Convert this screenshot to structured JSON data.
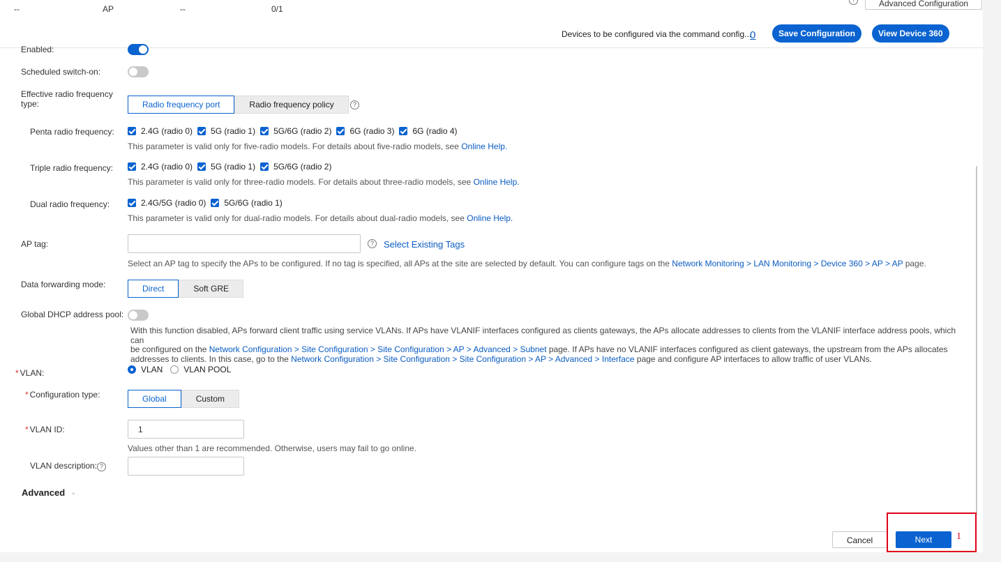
{
  "table_row": {
    "col1": "--",
    "col2": "AP",
    "col3": "--",
    "col4": "0/1"
  },
  "header": {
    "advanced_config": "Advanced Configuration",
    "devices_text": "Devices to be configured via the command config...",
    "devices_count": "0",
    "save_config": "Save Configuration",
    "view_device": "View Device 360"
  },
  "form": {
    "enabled_label": "Enabled:",
    "scheduled_label": "Scheduled switch-on:",
    "effective_label": "Effective radio frequency type:",
    "effective_options": [
      "Radio frequency port",
      "Radio frequency policy"
    ],
    "penta": {
      "label": "Penta radio frequency:",
      "options": [
        "2.4G (radio 0)",
        "5G (radio 1)",
        "5G/6G (radio 2)",
        "6G (radio 3)",
        "6G (radio 4)"
      ],
      "hint": "This parameter is valid only for five-radio models. For details about five-radio models, see ",
      "link": "Online Help."
    },
    "triple": {
      "label": "Triple radio frequency:",
      "options": [
        "2.4G (radio 0)",
        "5G (radio 1)",
        "5G/6G (radio 2)"
      ],
      "hint": "This parameter is valid only for three-radio models. For details about three-radio models, see ",
      "link": "Online Help."
    },
    "dual": {
      "label": "Dual radio frequency:",
      "options": [
        "2.4G/5G (radio 0)",
        "5G/6G (radio 1)"
      ],
      "hint": "This parameter is valid only for dual-radio models. For details about dual-radio models, see ",
      "link": "Online Help."
    },
    "ap_tag": {
      "label": "AP tag:",
      "value": "",
      "select_existing": "Select Existing Tags",
      "hint_before": "Select an AP tag to specify the APs to be configured. If no tag is specified, all APs at the site are selected by default. You can configure tags on the ",
      "hint_link": "Network Monitoring > LAN Monitoring > Device 360 > AP > AP",
      "hint_after": " page."
    },
    "forwarding": {
      "label": "Data forwarding mode:",
      "options": [
        "Direct",
        "Soft GRE"
      ]
    },
    "dhcp": {
      "label": "Global DHCP address pool:",
      "desc1": "With this function disabled, APs forward client traffic using service VLANs. If APs have VLANIF interfaces configured as clients gateways, the APs allocate addresses to clients from the VLANIF interface address pools, which can",
      "desc2a": "be configured on the ",
      "desc2link": "Network Configuration > Site Configuration > Site Configuration > AP > Advanced > Subnet",
      "desc2b": " page. If APs have no VLANIF interfaces configured as client gateways, the upstream from the APs allocates",
      "desc3a": "addresses to clients. In this case, go to the ",
      "desc3link": "Network Configuration > Site Configuration > Site Configuration > AP > Advanced > Interface",
      "desc3b": " page and configure AP interfaces to allow traffic of user VLANs."
    },
    "vlan": {
      "label": "VLAN:",
      "options": [
        "VLAN",
        "VLAN POOL"
      ]
    },
    "config_type": {
      "label": "Configuration type:",
      "options": [
        "Global",
        "Custom"
      ]
    },
    "vlan_id": {
      "label": "VLAN ID:",
      "value": "1",
      "hint": "Values other than 1 are recommended. Otherwise, users may fail to go online."
    },
    "vlan_desc": {
      "label": "VLAN description:",
      "value": ""
    },
    "advanced": "Advanced"
  },
  "footer": {
    "cancel": "Cancel",
    "next": "Next",
    "annotation": "1"
  },
  "colors": {
    "primary": "#0a63d0",
    "link": "#0a5cc2",
    "required": "#e0302b",
    "highlight_box": "#e0001a"
  }
}
